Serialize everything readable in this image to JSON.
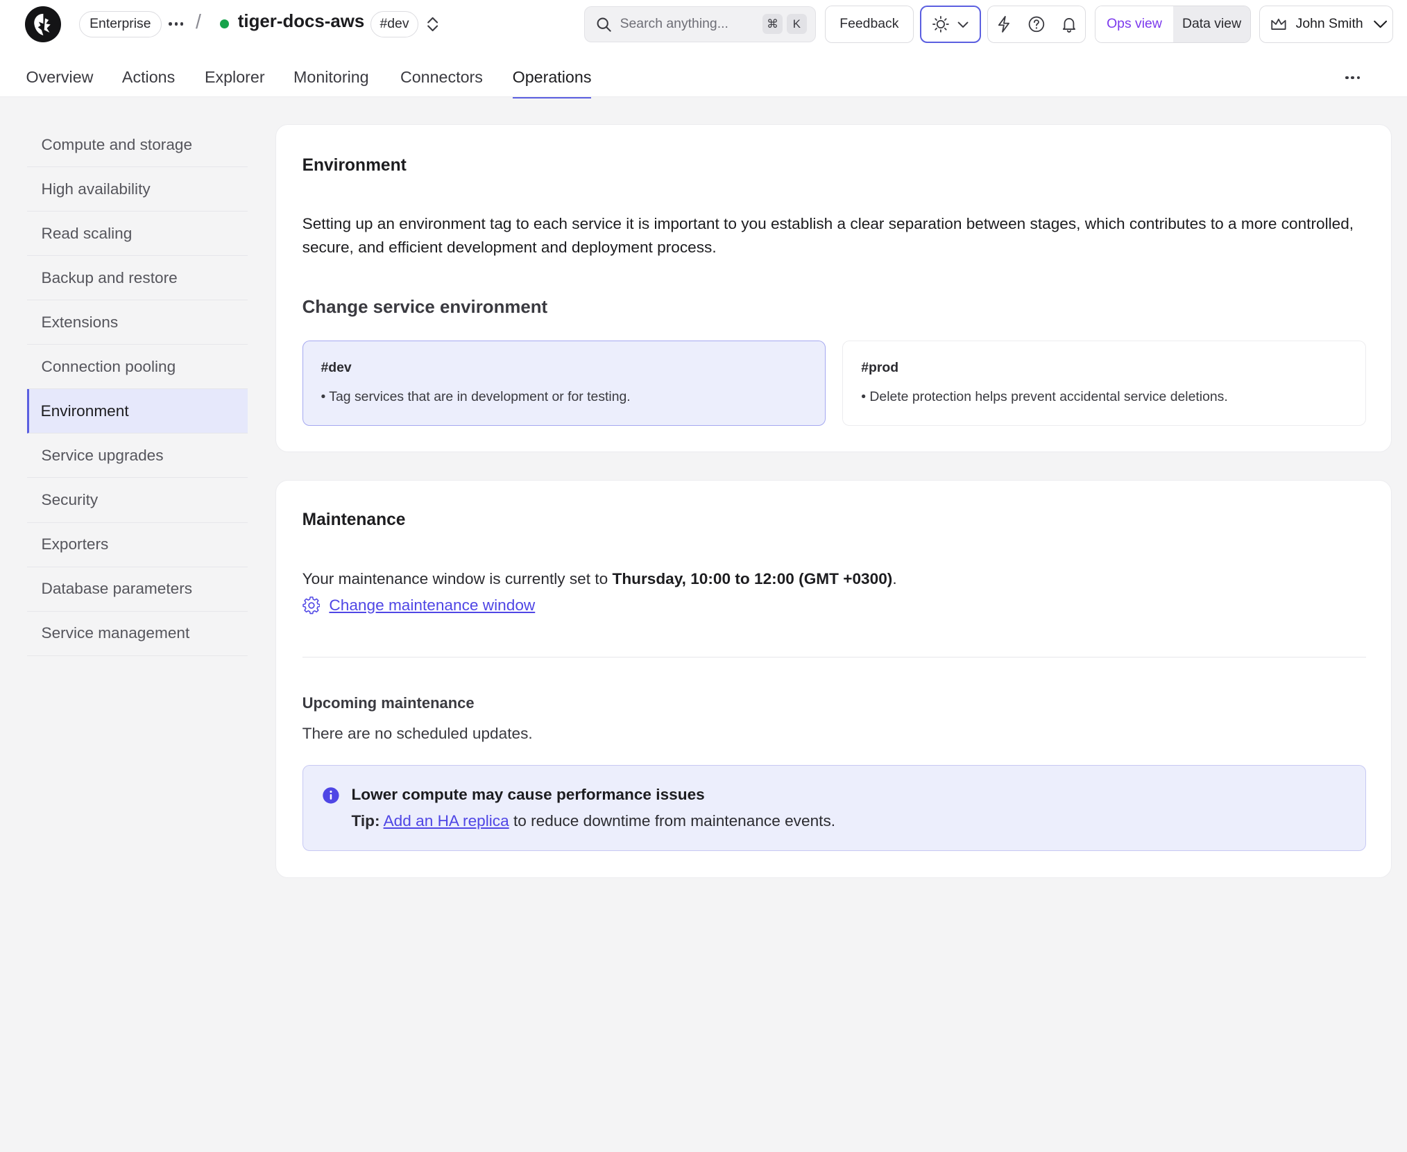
{
  "header": {
    "plan_label": "Enterprise",
    "service_name": "tiger-docs-aws",
    "env_badge": "#dev",
    "search_placeholder": "Search anything...",
    "shortcut_cmd": "⌘",
    "shortcut_key": "K",
    "feedback_label": "Feedback",
    "view_ops": "Ops view",
    "view_data": "Data view",
    "user_name": "John Smith"
  },
  "tabs": [
    {
      "label": "Overview"
    },
    {
      "label": "Actions"
    },
    {
      "label": "Explorer"
    },
    {
      "label": "Monitoring"
    },
    {
      "label": "Connectors"
    },
    {
      "label": "Operations",
      "active": true
    }
  ],
  "sidebar": {
    "items": [
      {
        "label": "Compute and storage"
      },
      {
        "label": "High availability"
      },
      {
        "label": "Read scaling"
      },
      {
        "label": "Backup and restore"
      },
      {
        "label": "Extensions"
      },
      {
        "label": "Connection pooling"
      },
      {
        "label": "Environment",
        "active": true
      },
      {
        "label": "Service upgrades"
      },
      {
        "label": "Security"
      },
      {
        "label": "Exporters"
      },
      {
        "label": "Database parameters"
      },
      {
        "label": "Service management"
      }
    ]
  },
  "environment": {
    "title": "Environment",
    "description": "Setting up an environment tag to each service it is important to you establish a clear separation between stages, which contributes to a more controlled, secure, and efficient development and deployment process.",
    "subtitle": "Change service environment",
    "options": [
      {
        "tag": "#dev",
        "hint": "• Tag services that are in development or for testing.",
        "selected": true
      },
      {
        "tag": "#prod",
        "hint": "• Delete protection helps prevent accidental service deletions.",
        "selected": false
      }
    ]
  },
  "maintenance": {
    "title": "Maintenance",
    "window_prefix": "Your maintenance window is currently set to ",
    "window_value": "Thursday, 10:00 to 12:00 (GMT +0300)",
    "window_suffix": ".",
    "change_link": "Change maintenance window",
    "upcoming_title": "Upcoming maintenance",
    "upcoming_text": "There are no scheduled updates.",
    "callout_title": "Lower compute may cause performance issues",
    "callout_tip_label": "Tip:",
    "callout_link": "Add an HA replica",
    "callout_tip_rest": " to reduce downtime from maintenance events."
  },
  "colors": {
    "accent": "#5b5fe0",
    "link": "#4f46e5",
    "status_running": "#16a34a",
    "ops_view_active": "#7c3aed"
  },
  "icons": [
    "logo-icon",
    "more-horizontal-icon",
    "chevron-updown-icon",
    "search-icon",
    "sun-icon",
    "chevron-down-icon",
    "lightning-icon",
    "help-icon",
    "bell-icon",
    "crown-icon",
    "gear-icon",
    "info-icon"
  ]
}
